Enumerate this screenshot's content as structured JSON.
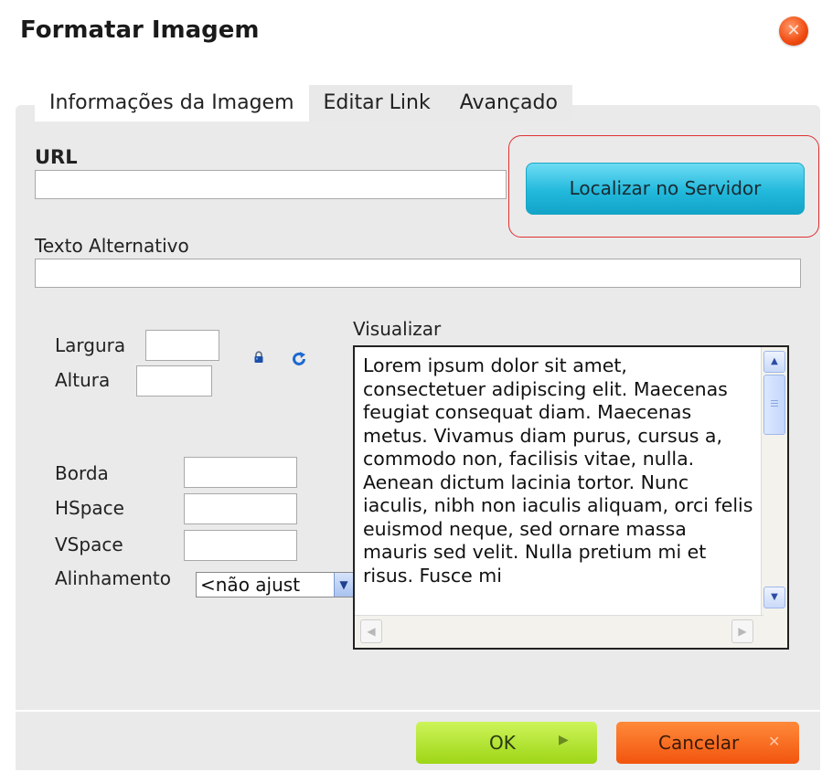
{
  "dialog": {
    "title": "Formatar Imagem",
    "close_icon": "close-icon",
    "accent_close": "#f04a10"
  },
  "tabs": [
    {
      "label": "Informações da Imagem",
      "active": true
    },
    {
      "label": "Editar Link",
      "active": false
    },
    {
      "label": "Avançado",
      "active": false
    }
  ],
  "form": {
    "url_label": "URL",
    "url_value": "",
    "browse_label": "Localizar no Servidor",
    "alt_label": "Texto Alternativo",
    "alt_value": "",
    "width_label": "Largura",
    "width_value": "",
    "height_label": "Altura",
    "height_value": "",
    "lock_icon": "lock-icon",
    "reset_icon": "reset-size-icon",
    "border_label": "Borda",
    "border_value": "",
    "hspace_label": "HSpace",
    "hspace_value": "",
    "vspace_label": "VSpace",
    "vspace_value": "",
    "align_label": "Alinhamento",
    "align_selected": "<não ajustado>",
    "align_visible": "<não ajust"
  },
  "preview": {
    "label": "Visualizar",
    "text": "Lorem ipsum dolor sit amet, consectetuer adipiscing elit. Maecenas feugiat consequat diam. Maecenas metus. Vivamus diam purus, cursus a, commodo non, facilisis vitae, nulla. Aenean dictum lacinia tortor. Nunc iaculis, nibh non iaculis aliquam, orci felis euismod neque, sed ornare massa mauris sed velit. Nulla pretium mi et risus. Fusce mi"
  },
  "footer": {
    "ok_label": "OK",
    "cancel_label": "Cancelar",
    "ok_color": "#9dd616",
    "cancel_color": "#f2540e"
  }
}
